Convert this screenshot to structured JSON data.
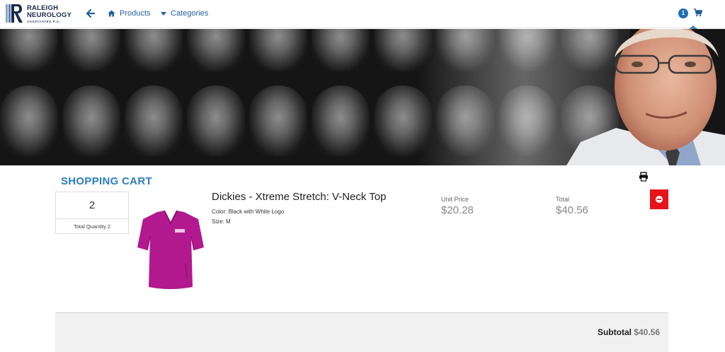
{
  "brand": {
    "name_line1": "RALEIGH",
    "name_line2": "NEUROLOGY",
    "name_line3": "ASSOCIATES P.A."
  },
  "nav": {
    "products_label": "Products",
    "categories_label": "Categories",
    "cart_count": "1"
  },
  "cart": {
    "title": "SHOPPING CART",
    "total_quantity_value": "2",
    "total_quantity_label": "Total Quantity 2",
    "items": [
      {
        "name": "Dickies - Xtreme Stretch: V-Neck Top",
        "color_line": "Color: Black with White Logo",
        "size_line": "Size: M",
        "unit_price_label": "Unit Price",
        "unit_price": "$20.28",
        "total_label": "Total",
        "total": "$40.56"
      }
    ],
    "subtotal_label": "Subtotal",
    "subtotal_value": "$40.56"
  },
  "colors": {
    "accent": "#2e7dbf",
    "nav_link": "#1f5f9c",
    "remove": "#e8141a",
    "product_garment": "#b2198f"
  },
  "icons": [
    "back-arrow-icon",
    "home-icon",
    "caret-down-icon",
    "cart-icon",
    "print-icon",
    "minus-circle-icon"
  ]
}
